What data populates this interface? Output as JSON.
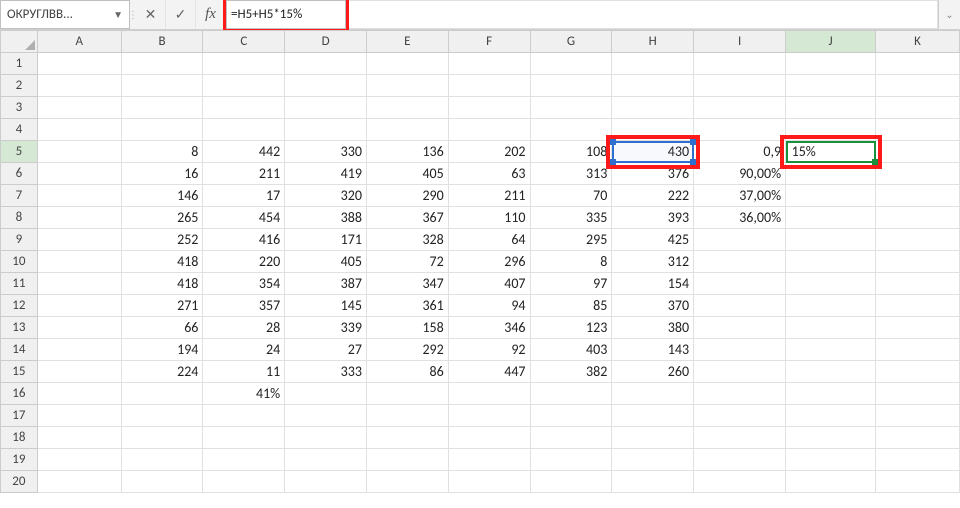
{
  "formula_bar": {
    "name_box": "ОКРУГЛВВ...",
    "cancel_tip": "✕",
    "confirm_tip": "✓",
    "fx_label": "fx",
    "formula": "=H5+H5*15%"
  },
  "columns": [
    "A",
    "B",
    "C",
    "D",
    "E",
    "F",
    "G",
    "H",
    "I",
    "J",
    "K"
  ],
  "row_numbers": [
    1,
    2,
    3,
    4,
    5,
    6,
    7,
    8,
    9,
    10,
    11,
    12,
    13,
    14,
    15,
    16,
    17,
    18,
    19,
    20
  ],
  "active": {
    "address": "J5",
    "display": "15%"
  },
  "reference": {
    "address": "H5"
  },
  "cells": {
    "B5": "8",
    "C5": "442",
    "D5": "330",
    "E5": "136",
    "F5": "202",
    "G5": "108",
    "H5": "430",
    "I5": "0,9",
    "J5": "15%",
    "B6": "16",
    "C6": "211",
    "D6": "419",
    "E6": "405",
    "F6": "63",
    "G6": "313",
    "H6": "376",
    "I6": "90,00%",
    "B7": "146",
    "C7": "17",
    "D7": "320",
    "E7": "290",
    "F7": "211",
    "G7": "70",
    "H7": "222",
    "I7": "37,00%",
    "B8": "265",
    "C8": "454",
    "D8": "388",
    "E8": "367",
    "F8": "110",
    "G8": "335",
    "H8": "393",
    "I8": "36,00%",
    "B9": "252",
    "C9": "416",
    "D9": "171",
    "E9": "328",
    "F9": "64",
    "G9": "295",
    "H9": "425",
    "B10": "418",
    "C10": "220",
    "D10": "405",
    "E10": "72",
    "F10": "296",
    "G10": "8",
    "H10": "312",
    "B11": "418",
    "C11": "354",
    "D11": "387",
    "E11": "347",
    "F11": "407",
    "G11": "97",
    "H11": "154",
    "B12": "271",
    "C12": "357",
    "D12": "145",
    "E12": "361",
    "F12": "94",
    "G12": "85",
    "H12": "370",
    "B13": "66",
    "C13": "28",
    "D13": "339",
    "E13": "158",
    "F13": "346",
    "G13": "123",
    "H13": "380",
    "B14": "194",
    "C14": "24",
    "D14": "27",
    "E14": "292",
    "F14": "92",
    "G14": "403",
    "H14": "143",
    "B15": "224",
    "C15": "11",
    "D15": "333",
    "E15": "86",
    "F15": "447",
    "G15": "382",
    "H15": "260",
    "C16": "41%"
  }
}
